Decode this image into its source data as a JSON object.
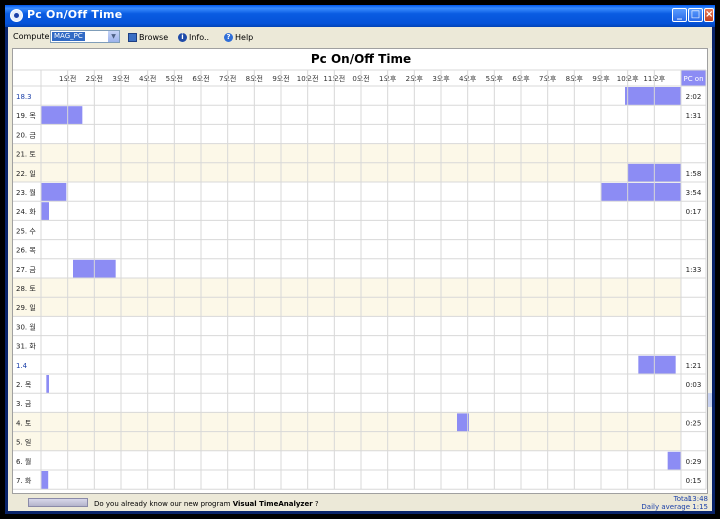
{
  "window": {
    "title": "Pc On/Off Time"
  },
  "toolbar": {
    "computer_label": "Computer",
    "computer_value": "MAG_PC",
    "browse_label": "Browse",
    "info_label": "Info..",
    "help_label": "Help"
  },
  "grid": {
    "title": "Pc On/Off Time",
    "pc_on_header": "PC on",
    "hours": [
      "1오전",
      "2오전",
      "3오전",
      "4오전",
      "5오전",
      "6오전",
      "7오전",
      "8오전",
      "9오전",
      "10오전",
      "11오전",
      "0오전",
      "1오후",
      "2오후",
      "3오후",
      "4오후",
      "5오후",
      "6오후",
      "7오후",
      "8오후",
      "9오후",
      "10오후",
      "11오후"
    ],
    "rows": [
      {
        "label": "18.3",
        "total": "2:02",
        "weekend": false,
        "blue": true,
        "blocks": [
          [
            21.9,
            24
          ]
        ]
      },
      {
        "label": "19. 목",
        "total": "1:31",
        "weekend": false,
        "blue": false,
        "blocks": [
          [
            0,
            1.55
          ]
        ]
      },
      {
        "label": "20. 금",
        "total": "",
        "weekend": false,
        "blue": false,
        "blocks": []
      },
      {
        "label": "21. 토",
        "total": "",
        "weekend": true,
        "blue": false,
        "blocks": []
      },
      {
        "label": "22. 일",
        "total": "1:58",
        "weekend": true,
        "blue": false,
        "blocks": [
          [
            22,
            24
          ]
        ]
      },
      {
        "label": "23. 월",
        "total": "3:54",
        "weekend": false,
        "blue": false,
        "blocks": [
          [
            0,
            0.95
          ],
          [
            21,
            24
          ]
        ]
      },
      {
        "label": "24. 화",
        "total": "0:17",
        "weekend": false,
        "blue": false,
        "blocks": [
          [
            0,
            0.3
          ]
        ]
      },
      {
        "label": "25. 수",
        "total": "",
        "weekend": false,
        "blue": false,
        "blocks": []
      },
      {
        "label": "26. 목",
        "total": "",
        "weekend": false,
        "blue": false,
        "blocks": []
      },
      {
        "label": "27. 금",
        "total": "1:33",
        "weekend": false,
        "blue": false,
        "blocks": [
          [
            1.2,
            2.8
          ]
        ]
      },
      {
        "label": "28. 토",
        "total": "",
        "weekend": true,
        "blue": false,
        "blocks": []
      },
      {
        "label": "29. 일",
        "total": "",
        "weekend": true,
        "blue": false,
        "blocks": []
      },
      {
        "label": "30. 월",
        "total": "",
        "weekend": false,
        "blue": false,
        "blocks": []
      },
      {
        "label": "31. 화",
        "total": "",
        "weekend": false,
        "blue": false,
        "blocks": []
      },
      {
        "label": "1.4",
        "total": "1:21",
        "weekend": false,
        "blue": true,
        "blocks": [
          [
            22.4,
            23.8
          ]
        ]
      },
      {
        "label": "2. 목",
        "total": "0:03",
        "weekend": false,
        "blue": false,
        "blocks": [
          [
            0.2,
            0.3
          ]
        ]
      },
      {
        "label": "3. 금",
        "total": "",
        "weekend": false,
        "blue": false,
        "blocks": []
      },
      {
        "label": "4. 토",
        "total": "0:25",
        "weekend": true,
        "blue": false,
        "blocks": [
          [
            15.6,
            16.05
          ]
        ]
      },
      {
        "label": "5. 일",
        "total": "",
        "weekend": true,
        "blue": false,
        "blocks": []
      },
      {
        "label": "6. 월",
        "total": "0:29",
        "weekend": false,
        "blue": false,
        "blocks": [
          [
            23.5,
            24
          ]
        ]
      },
      {
        "label": "7. 화",
        "total": "0:15",
        "weekend": false,
        "blue": false,
        "blocks": [
          [
            0,
            0.27
          ]
        ]
      }
    ]
  },
  "status": {
    "promo_text": "Do you already know our new program ",
    "promo_product": "Visual TimeAnalyzer",
    "promo_suffix": " ?",
    "total_label": "Total",
    "total_value": "13:48",
    "avg_label": "Daily average",
    "avg_value": "1:15"
  },
  "colors": {
    "block": "#8c8cf4",
    "weekend_bg": "#fcf8e8",
    "grid_line": "#d8d8d8",
    "label_blue": "#1a3fa8",
    "header_blue": "#8c8cf4"
  }
}
